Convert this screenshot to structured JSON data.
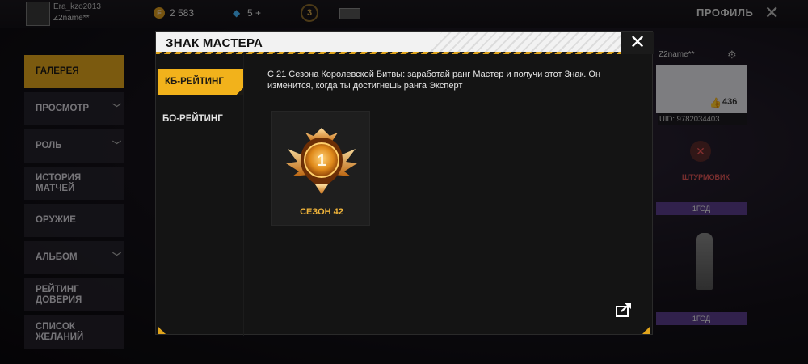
{
  "topbar": {
    "username": "Era_kzo2013",
    "usertag": "Z2name**",
    "coins": "2 583",
    "diamonds": "5 +",
    "level": "3",
    "profile_title": "ПРОФИЛЬ"
  },
  "sidebar": {
    "items": [
      {
        "label": "ГАЛЕРЕЯ"
      },
      {
        "label": "ПРОСМОТР"
      },
      {
        "label": "РОЛЬ"
      },
      {
        "label": "ИСТОРИЯ МАТЧЕЙ"
      },
      {
        "label": "ОРУЖИЕ"
      },
      {
        "label": "АЛЬБОМ"
      },
      {
        "label": "РЕЙТИНГ ДОВЕРИЯ"
      },
      {
        "label": "СПИСОК ЖЕЛАНИЙ"
      }
    ]
  },
  "right_panel": {
    "name": "Z2name**",
    "likes": "436",
    "uid": "UID: 9782034403",
    "role": "ШТУРМОВИК",
    "button1": "1ГОД",
    "button2": "1ГОД"
  },
  "modal": {
    "title": "ЗНАК МАСТЕРА",
    "tabs": [
      {
        "label": "КБ-РЕЙТИНГ"
      },
      {
        "label": "БО-РЕЙТИНГ"
      }
    ],
    "description": "С 21 Сезона Королевской Битвы: заработай ранг Мастер и получи этот Знак. Он изменится, когда ты достигнешь ранга Эксперт",
    "badge": {
      "rank_number": "1",
      "season_label": "СЕЗОН 42"
    }
  },
  "colors": {
    "accent": "#f2b21b",
    "badge_gold": "#f0b43a"
  }
}
